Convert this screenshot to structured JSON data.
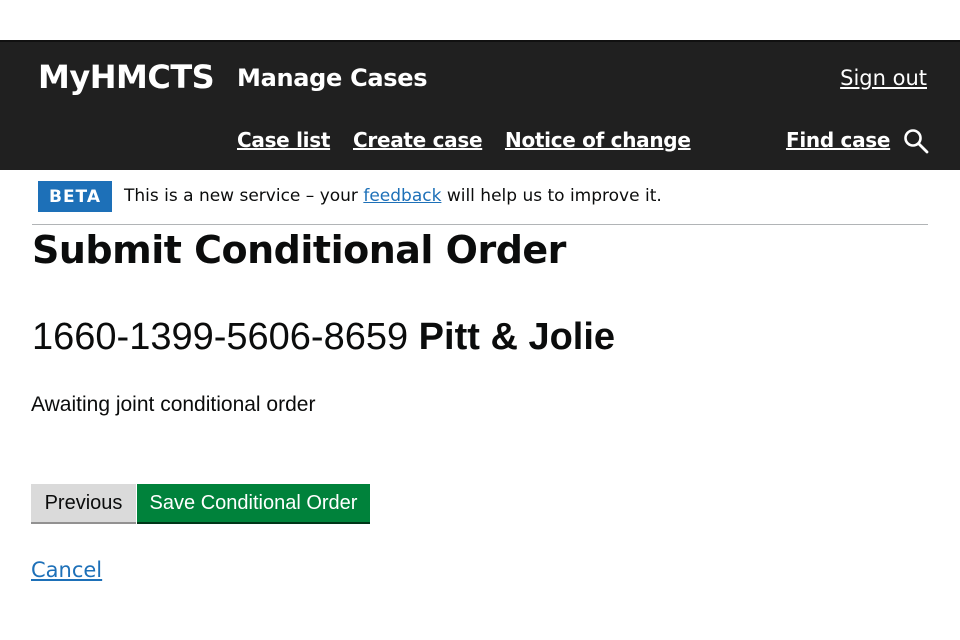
{
  "header": {
    "brand": "MyHMCTS",
    "service": "Manage Cases",
    "sign_out": "Sign out",
    "nav": {
      "case_list": "Case list",
      "create_case": "Create case",
      "notice_of_change": "Notice of change",
      "find_case": "Find case"
    },
    "search_icon": "search-icon"
  },
  "phase_banner": {
    "tag": "BETA",
    "text_before": "This is a new service – your",
    "link": "feedback",
    "text_after": "will help us to improve it."
  },
  "page": {
    "title": "Submit Conditional Order",
    "case_number": "1660-1399-5606-8659",
    "case_name": "Pitt & Jolie",
    "state": "Awaiting joint conditional order"
  },
  "actions": {
    "previous": "Previous",
    "save": "Save Conditional Order",
    "cancel": "Cancel"
  },
  "colors": {
    "header_bg": "#202020",
    "link": "#1d70b8",
    "primary_button": "#00823b",
    "secondary_button": "#dadada",
    "beta_tag": "#1d70b8"
  }
}
